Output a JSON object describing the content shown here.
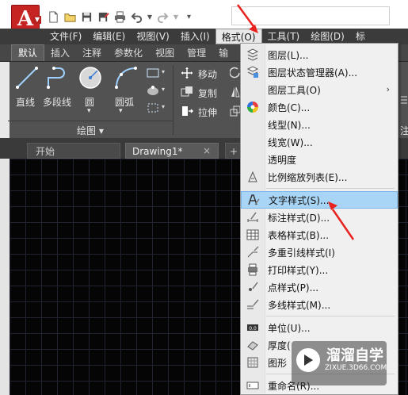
{
  "app": {
    "logo_letter": "A",
    "logo_color": "#c62323"
  },
  "quick_access": [
    "new-file-icon",
    "open-folder-icon",
    "save-icon",
    "save-as-icon",
    "print-icon",
    "undo-icon",
    "redo-icon",
    "customize-icon"
  ],
  "menubar": {
    "items": [
      "文件(F)",
      "编辑(E)",
      "视图(V)",
      "插入(I)",
      "格式(O)",
      "工具(T)",
      "绘图(D)",
      "标"
    ],
    "active_index": 4
  },
  "ribbon_tabs": {
    "items": [
      "默认",
      "插入",
      "注释",
      "参数化",
      "视图",
      "管理",
      "输"
    ],
    "active_index": 0
  },
  "ribbon": {
    "draw_tools": [
      "直线",
      "多段线",
      "圆",
      "圆弧"
    ],
    "panel_label": "绘图 ▾",
    "modify_tools": [
      "移动",
      "复制",
      "拉伸"
    ],
    "right_fragment": "注"
  },
  "doc_tabs": {
    "start": "开始",
    "drawing": "Drawing1*",
    "close": "×",
    "add": "+"
  },
  "format_menu": {
    "items": [
      {
        "label": "图层(L)...",
        "icon": "layer-icon"
      },
      {
        "label": "图层状态管理器(A)...",
        "icon": "layer-state-icon"
      },
      {
        "label": "图层工具(O)",
        "icon": "none",
        "submenu": "›"
      },
      {
        "label": "颜色(C)...",
        "icon": "color-wheel-icon"
      },
      {
        "label": "线型(N)...",
        "icon": "none"
      },
      {
        "label": "线宽(W)...",
        "icon": "none"
      },
      {
        "label": "透明度",
        "icon": "none"
      },
      {
        "label": "比例缩放列表(E)...",
        "icon": "scale-list-icon"
      },
      {
        "label": "文字样式(S)...",
        "icon": "text-style-icon"
      },
      {
        "label": "标注样式(D)...",
        "icon": "dim-style-icon"
      },
      {
        "label": "表格样式(B)...",
        "icon": "table-style-icon"
      },
      {
        "label": "多重引线样式(I)",
        "icon": "mleader-style-icon"
      },
      {
        "label": "打印样式(Y)...",
        "icon": "plot-style-icon"
      },
      {
        "label": "点样式(P)...",
        "icon": "point-style-icon"
      },
      {
        "label": "多线样式(M)...",
        "icon": "mline-style-icon"
      },
      {
        "label": "单位(U)...",
        "icon": "units-icon"
      },
      {
        "label": "厚度(",
        "icon": "thickness-icon"
      },
      {
        "label": "图形",
        "icon": "drawing-limits-icon"
      },
      {
        "label": "重命名(R)...",
        "icon": "rename-icon"
      }
    ],
    "highlighted_index": 8
  },
  "watermark": {
    "brand": "溜溜自学",
    "url": "ZIXUE.3D66.COM"
  },
  "colors": {
    "menubar_bg": "#3b3b3b",
    "ribbon_bg": "#525252",
    "highlight": "#a8d4f5",
    "arrow": "#e8231f",
    "canvas": "#050505"
  }
}
